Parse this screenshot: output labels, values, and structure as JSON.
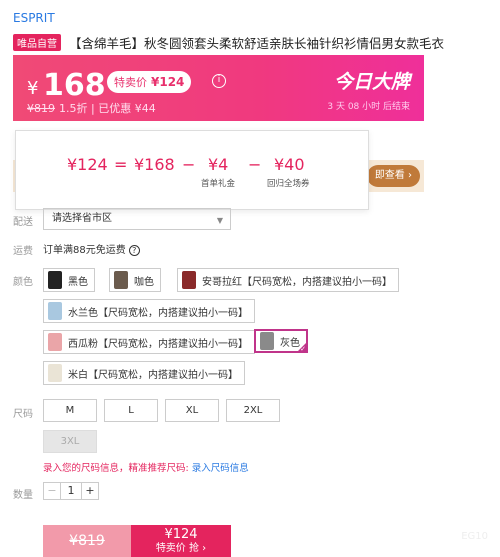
{
  "brand": "ESPRIT",
  "title": {
    "tag": "唯品自营",
    "text": "【含绵羊毛】秋冬圆领套头柔软舒适亲肤长袖针织衫情侣男女款毛衣"
  },
  "price": {
    "currency": "¥",
    "main": "168",
    "sale_label": "特卖价",
    "sale_price": "¥124",
    "original": "¥819",
    "discount": "1.5折",
    "saved": "| 已优惠 ¥44",
    "promo_title": "今日大牌",
    "countdown": "3 天 08 小时 后结束"
  },
  "coupon": {
    "button": "即查看 ›"
  },
  "tooltip": {
    "final": "¥124",
    "eq": "=",
    "base": "¥168",
    "minus1": "−",
    "coupon1": "¥4",
    "minus2": "−",
    "coupon2": "¥40",
    "coupon1_label": "首单礼金",
    "coupon2_label": "回归全场券"
  },
  "labels": {
    "delivery": "配送",
    "freight": "运费",
    "color": "颜色",
    "size": "尺码",
    "qty": "数量"
  },
  "delivery": {
    "placeholder": "请选择省市区"
  },
  "freight": {
    "text": "订单满88元免运费"
  },
  "colors": [
    {
      "label": "黑色",
      "swatch": "#222222"
    },
    {
      "label": "咖色",
      "swatch": "#6b5b4d"
    },
    {
      "label": "安哥拉红【尺码宽松，内搭建议拍小一码】",
      "swatch": "#8a2a2a"
    },
    {
      "label": "水兰色【尺码宽松，内搭建议拍小一码】",
      "swatch": "#a9c8e0"
    },
    {
      "label": "西瓜粉【尺码宽松，内搭建议拍小一码】",
      "swatch": "#eaa5a8"
    },
    {
      "label": "灰色",
      "swatch": "#8a8a8a"
    },
    {
      "label": "米白【尺码宽松，内搭建议拍小一码】",
      "swatch": "#eae4d6"
    }
  ],
  "selected_color": "灰色",
  "sizes": [
    "M",
    "L",
    "XL",
    "2XL",
    "3XL"
  ],
  "size_disabled": [
    "3XL"
  ],
  "size_hint": {
    "text": "录入您的尺码信息，精准推荐尺码:",
    "link": "录入尺码信息"
  },
  "qty": {
    "minus": "−",
    "value": "1",
    "plus": "+"
  },
  "buy": {
    "original": "¥819",
    "sale_price": "¥124",
    "sale_text": "特卖价 抢 ›"
  },
  "corner_text": "EG10",
  "colors_accent": {
    "pink": "#e4245e",
    "link": "#2a7ae2"
  }
}
